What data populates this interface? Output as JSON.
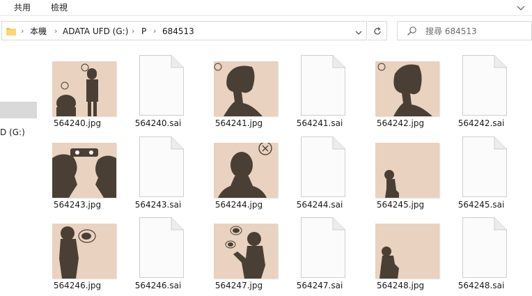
{
  "ribbon": {
    "tabs": [
      "共用",
      "檢視"
    ]
  },
  "address": {
    "crumbs": [
      "本機",
      "ADATA UFD (G:)",
      "P",
      "684513"
    ]
  },
  "search": {
    "placeholder": "搜尋 684513"
  },
  "nav": {
    "drive_label": "D (G:)"
  },
  "files": [
    {
      "name": "564240.jpg",
      "kind": "image",
      "art": 0
    },
    {
      "name": "564240.sai",
      "kind": "document"
    },
    {
      "name": "564241.jpg",
      "kind": "image",
      "art": 1
    },
    {
      "name": "564241.sai",
      "kind": "document"
    },
    {
      "name": "564242.jpg",
      "kind": "image",
      "art": 2
    },
    {
      "name": "564242.sai",
      "kind": "document"
    },
    {
      "name": "564243.jpg",
      "kind": "image",
      "art": 3
    },
    {
      "name": "564243.sai",
      "kind": "document"
    },
    {
      "name": "564244.jpg",
      "kind": "image",
      "art": 4
    },
    {
      "name": "564244.sai",
      "kind": "document"
    },
    {
      "name": "564245.jpg",
      "kind": "image",
      "art": 5
    },
    {
      "name": "564245.sai",
      "kind": "document"
    },
    {
      "name": "564246.jpg",
      "kind": "image",
      "art": 6
    },
    {
      "name": "564246.sai",
      "kind": "document"
    },
    {
      "name": "564247.jpg",
      "kind": "image",
      "art": 7
    },
    {
      "name": "564247.sai",
      "kind": "document"
    },
    {
      "name": "564248.jpg",
      "kind": "image",
      "art": 8
    },
    {
      "name": "564248.sai",
      "kind": "document"
    }
  ],
  "colors": {
    "thumb_background": "#e9d2bf",
    "silhouette": "#4a3f35",
    "folder_yellow": "#f5c84c",
    "nav_selected": "#d9d9d9"
  }
}
